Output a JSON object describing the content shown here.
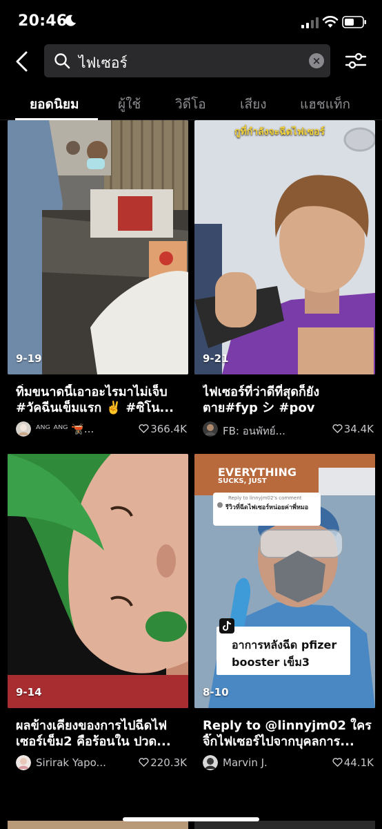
{
  "status": {
    "time": "20:46"
  },
  "search": {
    "query": "ไฟเซอร์",
    "clear": "×"
  },
  "tabs": [
    {
      "label": "ยอดนิยม",
      "active": true
    },
    {
      "label": "ผู้ใช้"
    },
    {
      "label": "วิดีโอ"
    },
    {
      "label": "เสียง"
    },
    {
      "label": "แฮชแท็ก"
    }
  ],
  "videos": [
    {
      "date": "9-19",
      "caption_line1": "ทิ่มขนาดนี้เอาอะไรมาไม่เจ็บ",
      "caption_line2": "#วัคฉีนเข็มแรก ✌️ #ซิโน...",
      "username": "ᴬᴺᴳ ᴬᴺᴳ 🫕...",
      "likes": "366.4K"
    },
    {
      "date": "9-21",
      "overlay_text": "กูที่กำลังจะฉีดไฟเซอร์",
      "caption_line1": "ไฟเซอร์ที่ว่าดีที่สุดก็ยัง",
      "caption_line2": "ตาย#fyp シ #pov",
      "username": "FB: อนพัทย์...",
      "likes": "34.4K"
    },
    {
      "date": "9-14",
      "caption_line1": "ผลข้างเคียงของการไปฉีดไฟ",
      "caption_line2": "เซอร์เข็ม2 คือร้อนใน ปวด...",
      "username": "Sirirak Yapo...",
      "likes": "220.3K"
    },
    {
      "date": "8-10",
      "overlay_title": "EVERYTHING",
      "overlay_subtitle": "SUCKS, JUST",
      "reply_label": "Reply to linnyjm02's comment",
      "reply_text": "รีวิวที่ฉีดไฟเซอร์หน่อยค่าพี่หมอ",
      "sticker_line1": "อาการหลังฉีด pfizer",
      "sticker_line2": "booster เข็ม3",
      "caption_line1": "Reply to @linnyjm02 ใคร",
      "caption_line2": "จิ๊กไฟเซอร์ไปจากบุคลการ...",
      "username": "Marvin J.",
      "likes": "44.1K"
    }
  ],
  "colors": {
    "background": "#000000",
    "search_bg": "#2a2a2c",
    "muted_text": "#8d8d92"
  }
}
